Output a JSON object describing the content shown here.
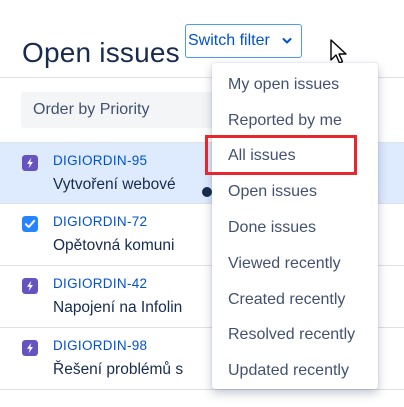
{
  "header": {
    "title": "Open issues",
    "switch_filter_label": "Switch filter"
  },
  "toolbar": {
    "order_label": "Order by Priority"
  },
  "issues": [
    {
      "key": "DIGIORDIN-95",
      "summary": "Vytvoření webové",
      "type_icon": "epic-icon",
      "type_color": "#6554c0",
      "checked": false,
      "selected": true
    },
    {
      "key": "DIGIORDIN-72",
      "summary": "Opětovná komuni",
      "type_icon": "checkbox-icon",
      "type_color": "#2684ff",
      "checked": true,
      "selected": false
    },
    {
      "key": "DIGIORDIN-42",
      "summary": "Napojení na Infolin",
      "type_icon": "epic-icon",
      "type_color": "#6554c0",
      "checked": false,
      "selected": false
    },
    {
      "key": "DIGIORDIN-98",
      "summary": "Řešení problémů s",
      "type_icon": "epic-icon",
      "type_color": "#6554c0",
      "checked": false,
      "selected": false
    }
  ],
  "filter_menu": {
    "items": [
      {
        "label": "My open issues",
        "active": false
      },
      {
        "label": "Reported by me",
        "active": false
      },
      {
        "label": "All issues",
        "active": false,
        "highlighted": true
      },
      {
        "label": "Open issues",
        "active": true
      },
      {
        "label": "Done issues",
        "active": false
      },
      {
        "label": "Viewed recently",
        "active": false
      },
      {
        "label": "Created recently",
        "active": false
      },
      {
        "label": "Resolved recently",
        "active": false
      },
      {
        "label": "Updated recently",
        "active": false
      }
    ]
  },
  "colors": {
    "accent": "#0052cc",
    "selected_row": "#deebff",
    "highlight": "#e8262d",
    "epic": "#6554c0",
    "task": "#2684ff"
  }
}
